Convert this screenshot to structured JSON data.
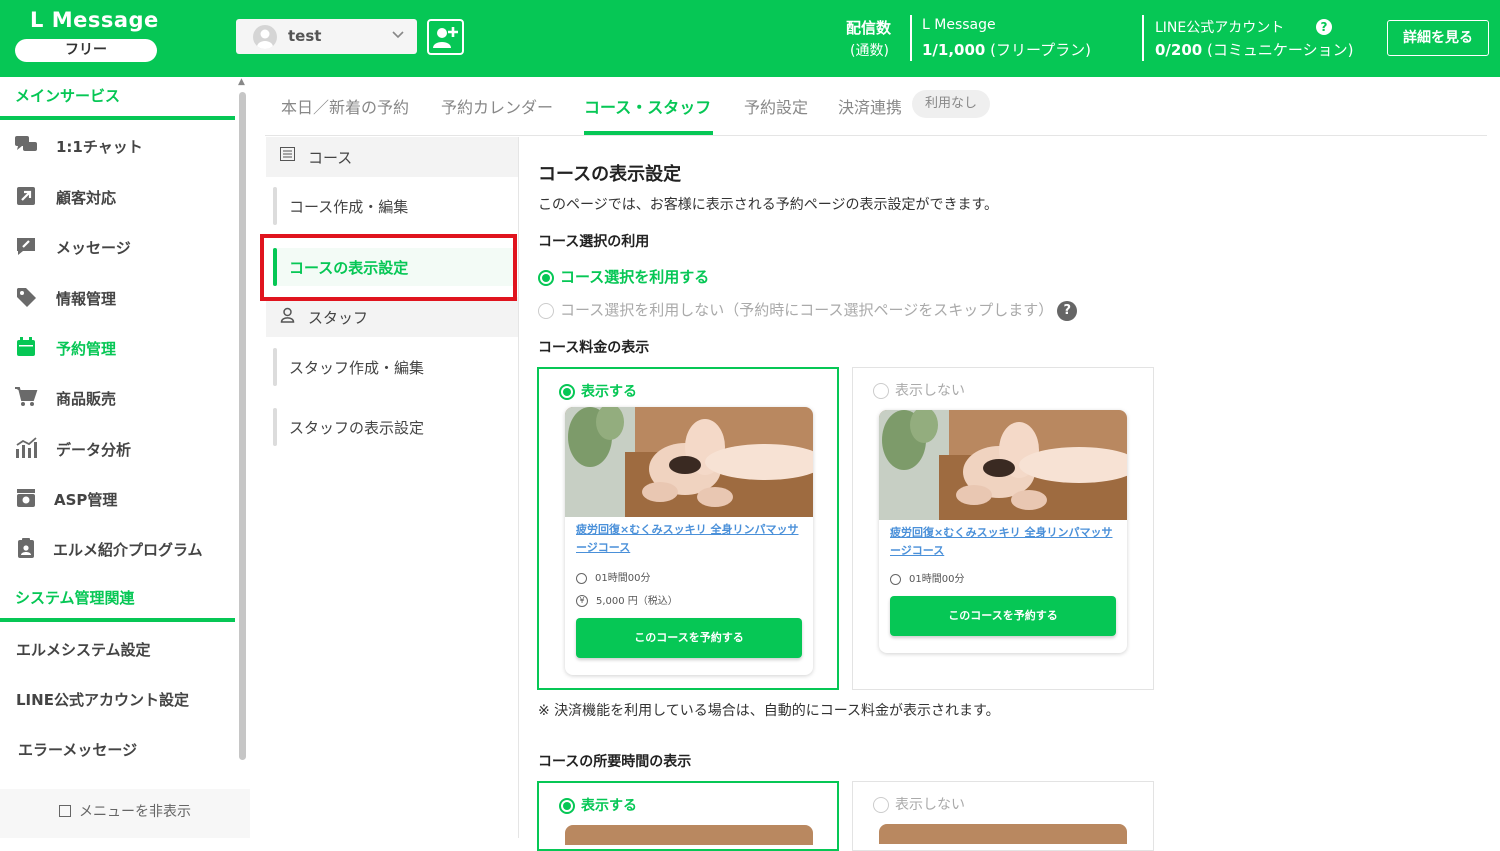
{
  "header": {
    "logo_title": "L Message",
    "logo_plan": "フリー",
    "account_name": "test",
    "delivery_label": "配信数",
    "delivery_sublabel": "(通数)",
    "lmessage_label": "L Message",
    "lmessage_value": "1/1,000",
    "lmessage_plan": "(フリープラン)",
    "line_label": "LINE公式アカウント",
    "line_value": "0/200",
    "line_plan": "(コミュニケーション)",
    "detail_button": "詳細を見る"
  },
  "sidebar": {
    "main_section": "メインサービス",
    "items": [
      {
        "label": "1:1チャット",
        "icon": "chat-icon"
      },
      {
        "label": "顧客対応",
        "icon": "external-link-icon"
      },
      {
        "label": "メッセージ",
        "icon": "edit-message-icon"
      },
      {
        "label": "情報管理",
        "icon": "tag-icon"
      },
      {
        "label": "予約管理",
        "icon": "calendar-icon"
      },
      {
        "label": "商品販売",
        "icon": "cart-icon"
      },
      {
        "label": "データ分析",
        "icon": "chart-icon"
      },
      {
        "label": "ASP管理",
        "icon": "asp-icon"
      },
      {
        "label": "エルメ紹介プログラム",
        "icon": "clipboard-user-icon"
      }
    ],
    "system_section": "システム管理関連",
    "system_items": [
      "エルメシステム設定",
      "LINE公式アカウント設定",
      "エラーメッセージ"
    ],
    "hide_menu": "メニューを非表示"
  },
  "tabs": [
    {
      "label": "本日／新着の予約"
    },
    {
      "label": "予約カレンダー"
    },
    {
      "label": "コース・スタッフ"
    },
    {
      "label": "予約設定"
    },
    {
      "label": "決済連携"
    }
  ],
  "tab_badge": "利用なし",
  "subnav": {
    "course_head": "コース",
    "course_items": [
      "コース作成・編集",
      "コースの表示設定"
    ],
    "staff_head": "スタッフ",
    "staff_items": [
      "スタッフ作成・編集",
      "スタッフの表示設定"
    ]
  },
  "main": {
    "title": "コースの表示設定",
    "description": "このページでは、お客様に表示される予約ページの表示設定ができます。",
    "course_select_title": "コース選択の利用",
    "course_select_on": "コース選択を利用する",
    "course_select_off": "コース選択を利用しない（予約時にコース選択ページをスキップします）",
    "price_title": "コース料金の表示",
    "show_label": "表示する",
    "hide_label": "表示しない",
    "card_title": "疲労回復×むくみスッキリ 全身リンパマッサージコース",
    "card_duration": "01時間00分",
    "card_price": "5,000 円（税込）",
    "card_button": "このコースを予約する",
    "note": "※ 決済機能を利用している場合は、自動的にコース料金が表示されます。",
    "duration_title": "コースの所要時間の表示"
  },
  "colors": {
    "accent": "#06c755",
    "highlight": "#e0141e"
  }
}
